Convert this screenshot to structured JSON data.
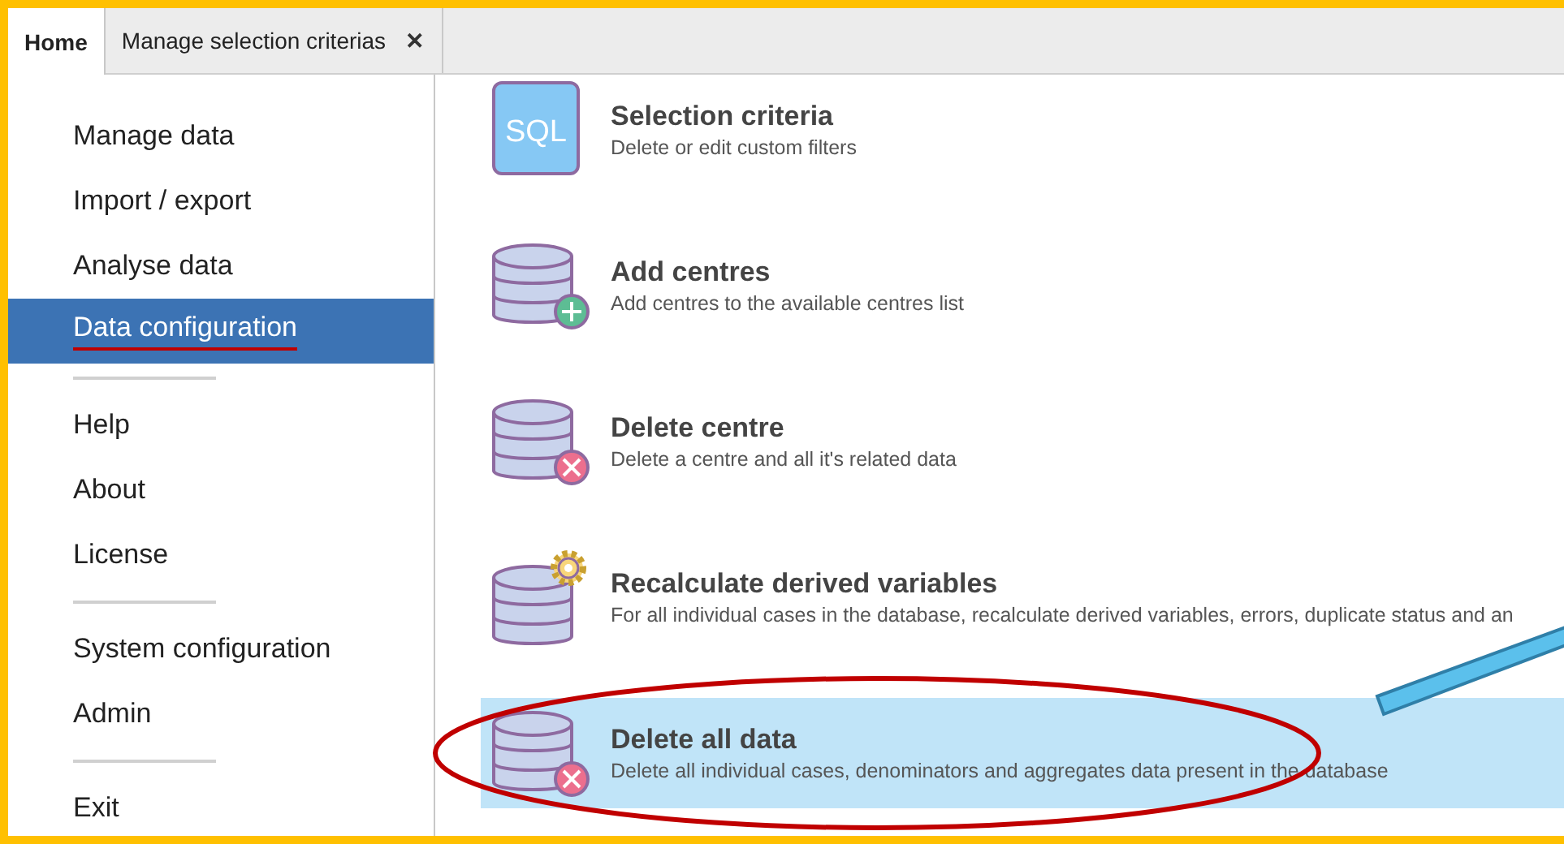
{
  "tabs": [
    {
      "label": "Home",
      "selected": true
    },
    {
      "label": "Manage selection criterias",
      "selected": false,
      "close": "✕"
    }
  ],
  "sidebar": {
    "items": [
      {
        "kind": "item",
        "label": "Manage data",
        "selected": false
      },
      {
        "kind": "item",
        "label": "Import / export",
        "selected": false
      },
      {
        "kind": "item",
        "label": "Analyse data",
        "selected": false
      },
      {
        "kind": "item",
        "label": "Data configuration",
        "selected": true,
        "underlined": true
      },
      {
        "kind": "separator"
      },
      {
        "kind": "item",
        "label": "Help",
        "selected": false
      },
      {
        "kind": "item",
        "label": "About",
        "selected": false
      },
      {
        "kind": "item",
        "label": "License",
        "selected": false
      },
      {
        "kind": "separator"
      },
      {
        "kind": "item",
        "label": "System configuration",
        "selected": false
      },
      {
        "kind": "item",
        "label": "Admin",
        "selected": false
      },
      {
        "kind": "separator"
      },
      {
        "kind": "item",
        "label": "Exit",
        "selected": false
      }
    ]
  },
  "actions": [
    {
      "kind": "sql",
      "icon_text": "SQL",
      "title": "Selection criteria",
      "description": "Delete or edit custom filters",
      "selected": false
    },
    {
      "kind": "add",
      "title": "Add centres",
      "description": "Add centres to the available centres list",
      "selected": false
    },
    {
      "kind": "delete",
      "title": "Delete centre",
      "description": "Delete a centre and all it's related data",
      "selected": false
    },
    {
      "kind": "gear",
      "title": "Recalculate derived variables",
      "description": "For all individual cases in the database, recalculate derived variables, errors, duplicate status and an",
      "selected": false
    },
    {
      "kind": "delete",
      "title": "Delete all data",
      "description": "Delete all individual cases, denominators and aggregates data present in the database",
      "selected": true,
      "circled": true
    }
  ],
  "pointer_arrow": true
}
